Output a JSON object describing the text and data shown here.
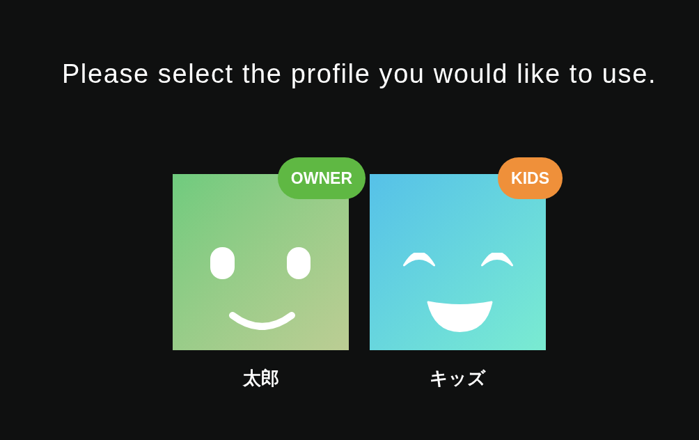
{
  "heading": "Please select the profile you would like to use.",
  "profiles": [
    {
      "kind": "owner",
      "name": "太郎",
      "badge": {
        "label": "OWNER",
        "color": "#5fb843"
      }
    },
    {
      "kind": "kids",
      "name": "キッズ",
      "badge": {
        "label": "KIDS",
        "color": "#ef903a"
      }
    }
  ]
}
